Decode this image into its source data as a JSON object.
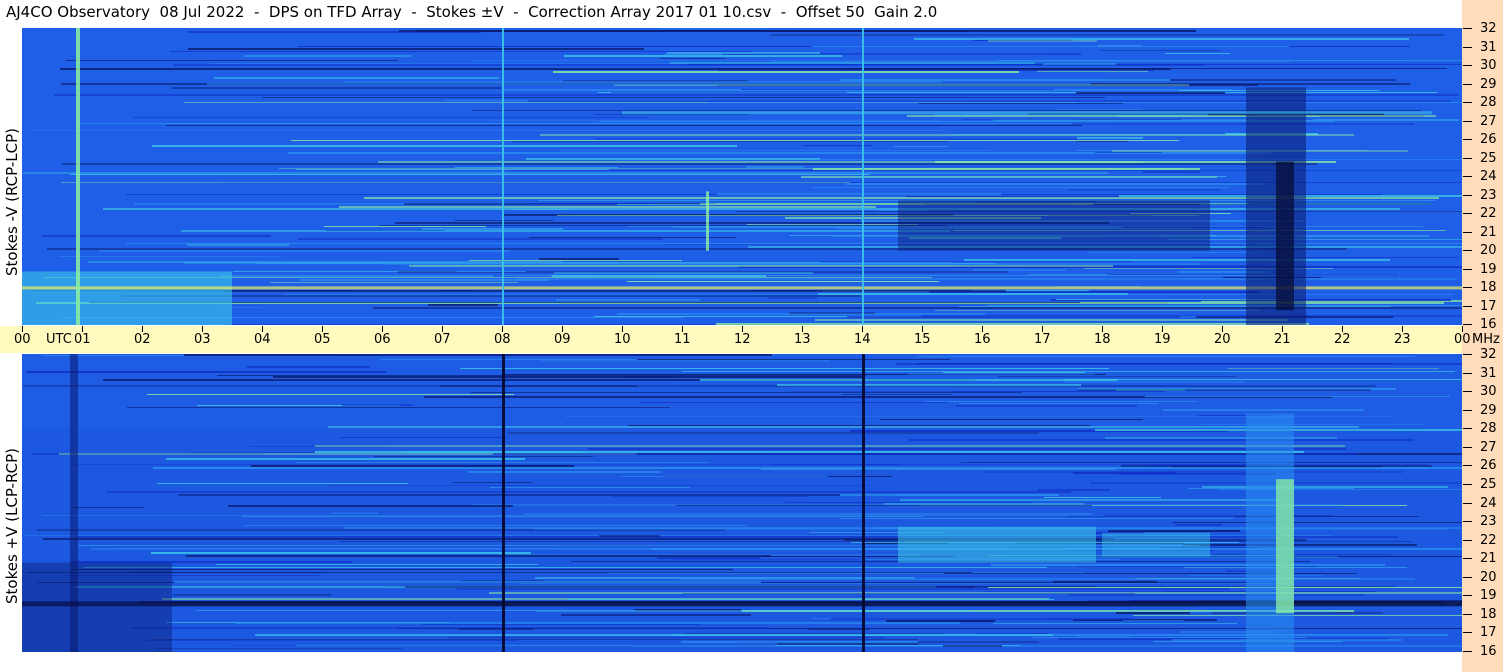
{
  "title": "AJ4CO Observatory  08 Jul 2022  -  DPS on TFD Array  -  Stokes ±V  -  Correction Array 2017 01 10.csv  -  Offset 50  Gain 2.0",
  "chart_data": [
    {
      "type": "heatmap",
      "panel": "top",
      "ylabel": "Stokes -V (RCP-LCP)",
      "x_axis": {
        "unit_label": "UTC",
        "range": [
          "00",
          "00"
        ],
        "ticks": [
          "00",
          "01",
          "02",
          "03",
          "04",
          "05",
          "06",
          "07",
          "08",
          "09",
          "10",
          "11",
          "12",
          "13",
          "14",
          "15",
          "16",
          "17",
          "18",
          "19",
          "20",
          "21",
          "22",
          "23",
          "00"
        ]
      },
      "y_axis": {
        "unit_label": "MHz",
        "range": [
          16,
          32
        ],
        "ticks": [
          32,
          31,
          30,
          29,
          28,
          27,
          26,
          25,
          24,
          23,
          22,
          21,
          20,
          19,
          18,
          17,
          16
        ]
      },
      "colormap": [
        "#0a1a6e",
        "#1030c8",
        "#1f5fe8",
        "#2a8ff0",
        "#3cc7e8",
        "#8ef0a0",
        "#f0f060"
      ],
      "dominant_color": "#1f5fe8"
    },
    {
      "type": "heatmap",
      "panel": "bottom",
      "ylabel": "Stokes +V (LCP-RCP)",
      "x_axis": {
        "unit_label": "UTC",
        "range": [
          "00",
          "00"
        ],
        "ticks": [
          "00",
          "01",
          "02",
          "03",
          "04",
          "05",
          "06",
          "07",
          "08",
          "09",
          "10",
          "11",
          "12",
          "13",
          "14",
          "15",
          "16",
          "17",
          "18",
          "19",
          "20",
          "21",
          "22",
          "23",
          "00"
        ]
      },
      "y_axis": {
        "unit_label": "MHz",
        "range": [
          16,
          32
        ],
        "ticks": [
          32,
          31,
          30,
          29,
          28,
          27,
          26,
          25,
          24,
          23,
          22,
          21,
          20,
          19,
          18,
          17,
          16
        ]
      },
      "colormap": [
        "#0a1a6e",
        "#1030c8",
        "#1f5fe8",
        "#2a8ff0",
        "#3cc7e8",
        "#8ef0a0",
        "#f0f060"
      ],
      "dominant_color": "#1c58e0"
    }
  ],
  "axis_band_color": "#fffbbf",
  "mhz_rail_color": "#ffdcbb"
}
